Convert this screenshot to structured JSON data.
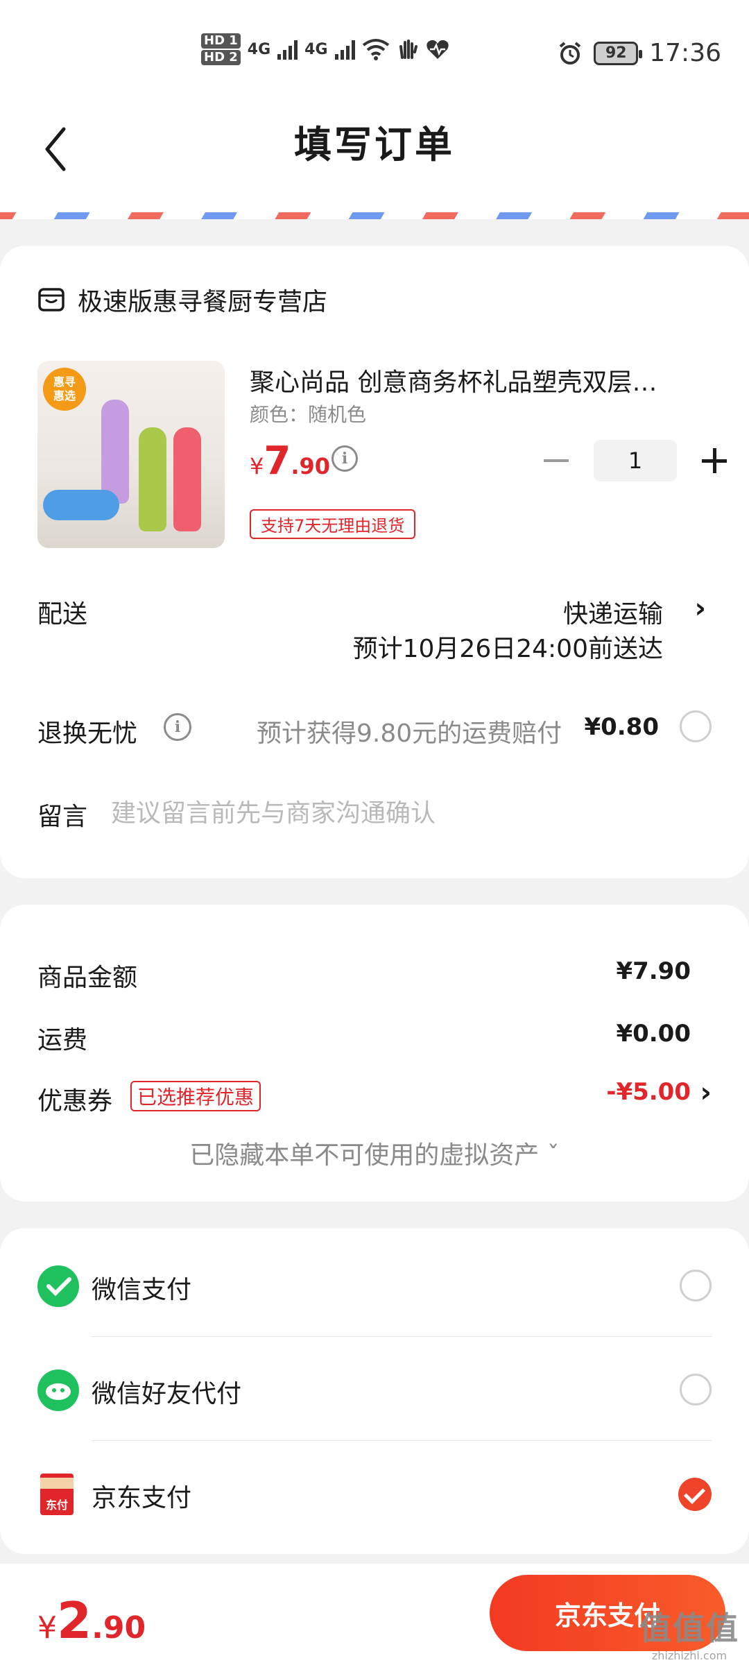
{
  "status_bar": {
    "hd1": "HD 1",
    "hd2": "HD 2",
    "net1": "4G",
    "net2": "4G",
    "battery": "92",
    "time": "17:36"
  },
  "header": {
    "title": "填写订单",
    "back_icon": "chevron-left-icon"
  },
  "shop": {
    "icon": "shop-icon",
    "name": "极速版惠寻餐厨专营店"
  },
  "product": {
    "badge": "惠寻\n惠选",
    "title": "聚心尚品 创意商务杯礼品塑壳双层…",
    "spec": "颜色：随机色",
    "price_currency": "¥",
    "price_int": "7",
    "price_dec": ".90",
    "quantity": "1",
    "return_tag": "支持7天无理由退货"
  },
  "delivery": {
    "label": "配送",
    "method": "快递运输",
    "eta": "预计10月26日24:00前送达"
  },
  "refund_insurance": {
    "label": "退换无忧",
    "text": "预计获得9.80元的运费赔付",
    "price": "¥0.80",
    "selected": false
  },
  "message": {
    "label": "留言",
    "placeholder": "建议留言前先与商家沟通确认"
  },
  "summary": {
    "goods_label": "商品金额",
    "goods_value": "¥7.90",
    "shipping_label": "运费",
    "shipping_value": "¥0.00",
    "coupon_label": "优惠券",
    "coupon_tag": "已选推荐优惠",
    "coupon_value": "-¥5.00",
    "hidden_assets": "已隐藏本单不可使用的虚拟资产 ˇ"
  },
  "payment_methods": [
    {
      "label": "微信支付",
      "icon": "wechat-pay-icon",
      "selected": false
    },
    {
      "label": "微信好友代付",
      "icon": "wechat-friend-pay-icon",
      "selected": false
    },
    {
      "label": "京东支付",
      "icon": "jd-pay-icon",
      "icon_text": "东付",
      "selected": true
    }
  ],
  "bottom": {
    "total_currency": "¥",
    "total_int": "2",
    "total_dec": ".90",
    "pay_button": "京东支付",
    "watermark_big": "值值值",
    "watermark_small": "zhizhizhi.com"
  },
  "colors": {
    "accent": "#e0252b",
    "pay_button": "#f23a22",
    "wechat": "#1fc15f"
  }
}
